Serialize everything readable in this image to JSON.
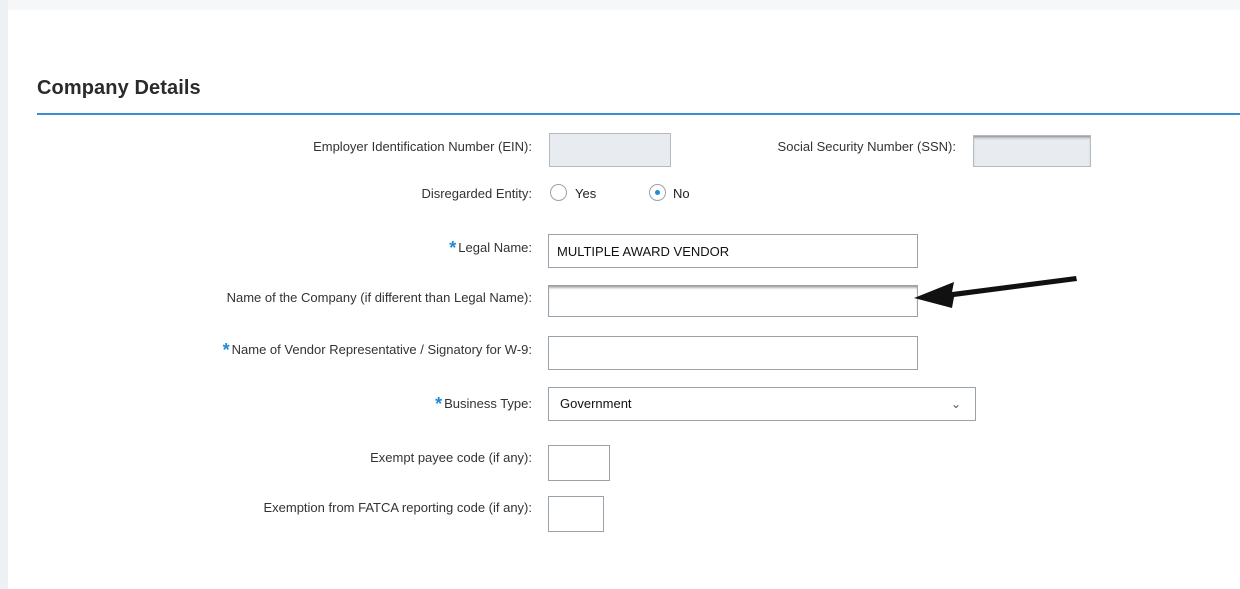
{
  "section": {
    "title": "Company Details"
  },
  "fields": {
    "ein": {
      "label": "Employer Identification Number (EIN):",
      "value": ""
    },
    "ssn": {
      "label": "Social Security Number (SSN):",
      "value": ""
    },
    "disregarded": {
      "label": "Disregarded Entity:",
      "options": [
        "Yes",
        "No"
      ],
      "selected": "No"
    },
    "legal_name": {
      "label": "Legal Name:",
      "value": "MULTIPLE AWARD VENDOR"
    },
    "company_name": {
      "label": "Name of the Company (if different than Legal Name):",
      "value": ""
    },
    "representative": {
      "label": "Name of Vendor Representative / Signatory for W-9:",
      "value": ""
    },
    "business_type": {
      "label": "Business Type:",
      "value": "Government"
    },
    "exempt_payee": {
      "label": "Exempt payee code (if any):",
      "value": ""
    },
    "fatca": {
      "label": "Exemption from FATCA reporting code (if any):",
      "value": ""
    }
  },
  "annotation": {
    "arrow": "black-arrow-icon"
  },
  "colors": {
    "accent": "#1d8bd6",
    "rule": "#3b8fd0"
  }
}
